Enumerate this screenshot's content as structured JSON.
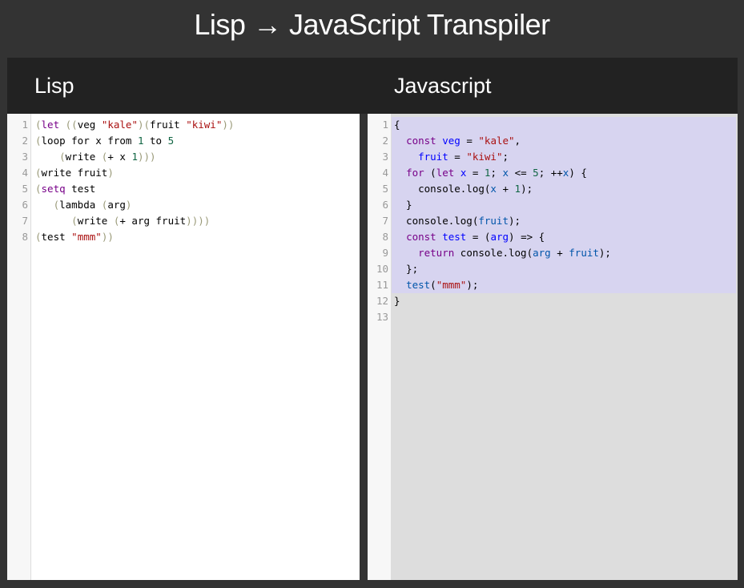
{
  "app": {
    "title": "Lisp → JavaScript Transpiler"
  },
  "panels": {
    "left_title": "Lisp",
    "right_title": "Javascript"
  },
  "lisp_editor": {
    "lines": [
      {
        "n": "1",
        "tokens": [
          [
            "b",
            "("
          ],
          [
            "k",
            "let"
          ],
          [
            "p",
            " "
          ],
          [
            "b",
            "(("
          ],
          [
            "p",
            "veg "
          ],
          [
            "s",
            "\"kale\""
          ],
          [
            "b",
            ")("
          ],
          [
            "p",
            "fruit "
          ],
          [
            "s",
            "\"kiwi\""
          ],
          [
            "b",
            "))"
          ]
        ]
      },
      {
        "n": "2",
        "tokens": [
          [
            "b",
            "("
          ],
          [
            "p",
            "loop for x from "
          ],
          [
            "num",
            "1"
          ],
          [
            "p",
            " to "
          ],
          [
            "num",
            "5"
          ]
        ]
      },
      {
        "n": "3",
        "tokens": [
          [
            "p",
            "    "
          ],
          [
            "b",
            "("
          ],
          [
            "p",
            "write "
          ],
          [
            "b",
            "("
          ],
          [
            "p",
            "+ x "
          ],
          [
            "num",
            "1"
          ],
          [
            "b",
            ")))"
          ]
        ]
      },
      {
        "n": "4",
        "tokens": [
          [
            "b",
            "("
          ],
          [
            "p",
            "write fruit"
          ],
          [
            "b",
            ")"
          ]
        ]
      },
      {
        "n": "5",
        "tokens": [
          [
            "b",
            "("
          ],
          [
            "k",
            "setq"
          ],
          [
            "p",
            " test"
          ]
        ]
      },
      {
        "n": "6",
        "tokens": [
          [
            "p",
            "   "
          ],
          [
            "b",
            "("
          ],
          [
            "p",
            "lambda "
          ],
          [
            "b",
            "("
          ],
          [
            "p",
            "arg"
          ],
          [
            "b",
            ")"
          ]
        ]
      },
      {
        "n": "7",
        "tokens": [
          [
            "p",
            "      "
          ],
          [
            "b",
            "("
          ],
          [
            "p",
            "write "
          ],
          [
            "b",
            "("
          ],
          [
            "p",
            "+ arg fruit"
          ],
          [
            "b",
            "))))"
          ]
        ]
      },
      {
        "n": "8",
        "tokens": [
          [
            "b",
            "("
          ],
          [
            "p",
            "test "
          ],
          [
            "s",
            "\"mmm\""
          ],
          [
            "b",
            "))"
          ]
        ]
      }
    ]
  },
  "js_editor": {
    "lines": [
      {
        "n": "1",
        "tokens": [
          [
            "p",
            "{"
          ]
        ]
      },
      {
        "n": "2",
        "tokens": [
          [
            "p",
            "  "
          ],
          [
            "k",
            "const"
          ],
          [
            "p",
            " "
          ],
          [
            "d",
            "veg"
          ],
          [
            "p",
            " = "
          ],
          [
            "s",
            "\"kale\""
          ],
          [
            "p",
            ","
          ]
        ]
      },
      {
        "n": "3",
        "tokens": [
          [
            "p",
            "    "
          ],
          [
            "d",
            "fruit"
          ],
          [
            "p",
            " = "
          ],
          [
            "s",
            "\"kiwi\""
          ],
          [
            "p",
            ";"
          ]
        ]
      },
      {
        "n": "4",
        "tokens": [
          [
            "p",
            "  "
          ],
          [
            "k",
            "for"
          ],
          [
            "p",
            " ("
          ],
          [
            "k",
            "let"
          ],
          [
            "p",
            " "
          ],
          [
            "d",
            "x"
          ],
          [
            "p",
            " = "
          ],
          [
            "num",
            "1"
          ],
          [
            "p",
            "; "
          ],
          [
            "v",
            "x"
          ],
          [
            "p",
            " <= "
          ],
          [
            "num",
            "5"
          ],
          [
            "p",
            "; ++"
          ],
          [
            "v",
            "x"
          ],
          [
            "p",
            ") {"
          ]
        ]
      },
      {
        "n": "5",
        "tokens": [
          [
            "p",
            "    console.log("
          ],
          [
            "v",
            "x"
          ],
          [
            "p",
            " + "
          ],
          [
            "num",
            "1"
          ],
          [
            "p",
            ");"
          ]
        ]
      },
      {
        "n": "6",
        "tokens": [
          [
            "p",
            "  }"
          ]
        ]
      },
      {
        "n": "7",
        "tokens": [
          [
            "p",
            "  console.log("
          ],
          [
            "v",
            "fruit"
          ],
          [
            "p",
            ");"
          ]
        ]
      },
      {
        "n": "8",
        "tokens": [
          [
            "p",
            "  "
          ],
          [
            "k",
            "const"
          ],
          [
            "p",
            " "
          ],
          [
            "d",
            "test"
          ],
          [
            "p",
            " = ("
          ],
          [
            "d",
            "arg"
          ],
          [
            "p",
            ") => {"
          ]
        ]
      },
      {
        "n": "9",
        "tokens": [
          [
            "p",
            "    "
          ],
          [
            "k",
            "return"
          ],
          [
            "p",
            " console.log("
          ],
          [
            "v",
            "arg"
          ],
          [
            "p",
            " + "
          ],
          [
            "v",
            "fruit"
          ],
          [
            "p",
            ");"
          ]
        ]
      },
      {
        "n": "10",
        "tokens": [
          [
            "p",
            "  };"
          ]
        ]
      },
      {
        "n": "11",
        "tokens": [
          [
            "p",
            "  "
          ],
          [
            "v",
            "test"
          ],
          [
            "p",
            "("
          ],
          [
            "s",
            "\"mmm\""
          ],
          [
            "p",
            ");"
          ]
        ]
      },
      {
        "n": "12",
        "tokens": [
          [
            "p",
            "}"
          ]
        ]
      },
      {
        "n": "13",
        "tokens": []
      }
    ],
    "selected_lines": [
      "1",
      "2",
      "3",
      "4",
      "5",
      "6",
      "7",
      "8",
      "9",
      "10",
      "11"
    ]
  },
  "colors": {
    "background": "#333333",
    "header": "#222222",
    "selection": "#d7d4f0",
    "keyword": "#770088",
    "string": "#aa1111",
    "number": "#116644",
    "definition": "#0000ff",
    "variable": "#0055aa"
  }
}
